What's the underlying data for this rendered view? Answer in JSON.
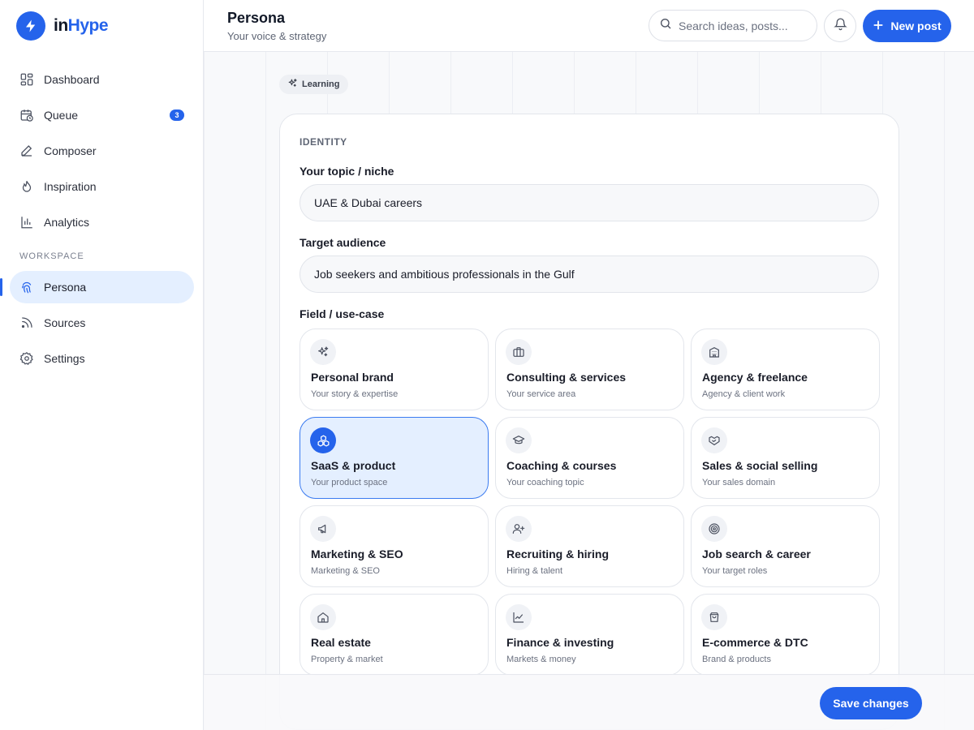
{
  "brand": {
    "name_prefix": "in",
    "name_suffix": "Hype",
    "accent": "#2563eb"
  },
  "sidebar": {
    "items": [
      {
        "label": "Dashboard",
        "icon": "grid-icon"
      },
      {
        "label": "Queue",
        "icon": "calendar-clock-icon",
        "badge": "3"
      },
      {
        "label": "Composer",
        "icon": "pen-icon"
      },
      {
        "label": "Inspiration",
        "icon": "flame-icon"
      },
      {
        "label": "Analytics",
        "icon": "bar-chart-icon"
      }
    ],
    "section_label": "WORKSPACE",
    "workspace_items": [
      {
        "label": "Persona",
        "icon": "fingerprint-icon",
        "active": true
      },
      {
        "label": "Sources",
        "icon": "rss-icon"
      },
      {
        "label": "Settings",
        "icon": "gear-icon"
      }
    ]
  },
  "header": {
    "title": "Persona",
    "subtitle": "Your voice & strategy",
    "search_placeholder": "Search ideas, posts...",
    "new_post_label": "New post"
  },
  "main": {
    "chip_label": "Learning",
    "section_label": "IDENTITY",
    "topic_label": "Your topic / niche",
    "topic_value": "UAE & Dubai careers",
    "audience_label": "Target audience",
    "audience_value": "Job seekers and ambitious professionals in the Gulf",
    "field_label": "Field / use-case",
    "tiles": [
      {
        "title": "Personal brand",
        "subtitle": "Your story & expertise",
        "icon": "sparkles-icon"
      },
      {
        "title": "Consulting & services",
        "subtitle": "Your service area",
        "icon": "briefcase-icon"
      },
      {
        "title": "Agency & freelance",
        "subtitle": "Agency & client work",
        "icon": "building-icon"
      },
      {
        "title": "SaaS & product",
        "subtitle": "Your product space",
        "icon": "boxes-icon",
        "selected": true
      },
      {
        "title": "Coaching & courses",
        "subtitle": "Your coaching topic",
        "icon": "graduation-cap-icon"
      },
      {
        "title": "Sales & social selling",
        "subtitle": "Your sales domain",
        "icon": "handshake-icon"
      },
      {
        "title": "Marketing & SEO",
        "subtitle": "Marketing & SEO",
        "icon": "megaphone-icon"
      },
      {
        "title": "Recruiting & hiring",
        "subtitle": "Hiring & talent",
        "icon": "user-plus-icon"
      },
      {
        "title": "Job search & career",
        "subtitle": "Your target roles",
        "icon": "target-icon"
      },
      {
        "title": "Real estate",
        "subtitle": "Property & market",
        "icon": "house-icon"
      },
      {
        "title": "Finance & investing",
        "subtitle": "Markets & money",
        "icon": "line-chart-icon"
      },
      {
        "title": "E-commerce & DTC",
        "subtitle": "Brand & products",
        "icon": "shopping-bag-icon"
      }
    ]
  },
  "footer": {
    "save_label": "Save changes"
  }
}
